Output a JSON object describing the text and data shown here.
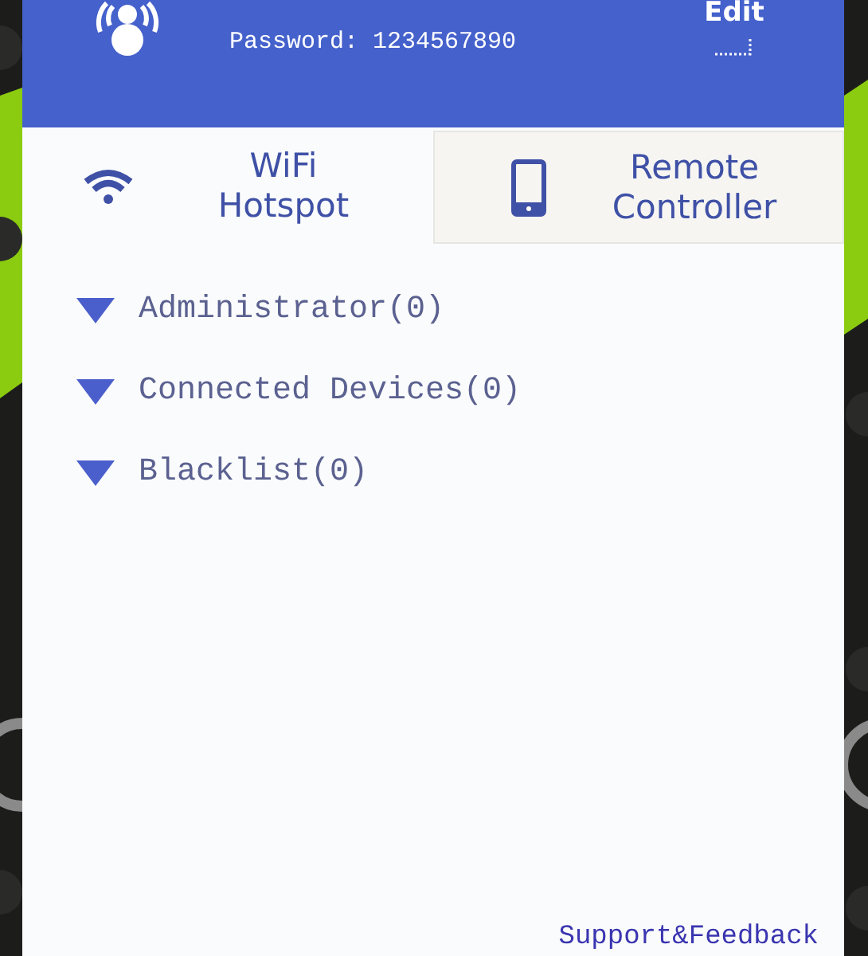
{
  "header": {
    "password": "Password: 1234567890",
    "edit_button": "Edit"
  },
  "tabs": [
    {
      "label": "WiFi\nHotspot",
      "kind": "wifi",
      "selected": true
    },
    {
      "label": "Remote\nController",
      "kind": "phone",
      "selected": false
    }
  ],
  "groups": [
    {
      "label": "Administrator(0)",
      "expanded": true
    },
    {
      "label": "Connected Devices(0)",
      "expanded": true
    },
    {
      "label": "Blacklist(0)",
      "expanded": true
    }
  ],
  "footer": {
    "link": "Support&Feedback"
  }
}
